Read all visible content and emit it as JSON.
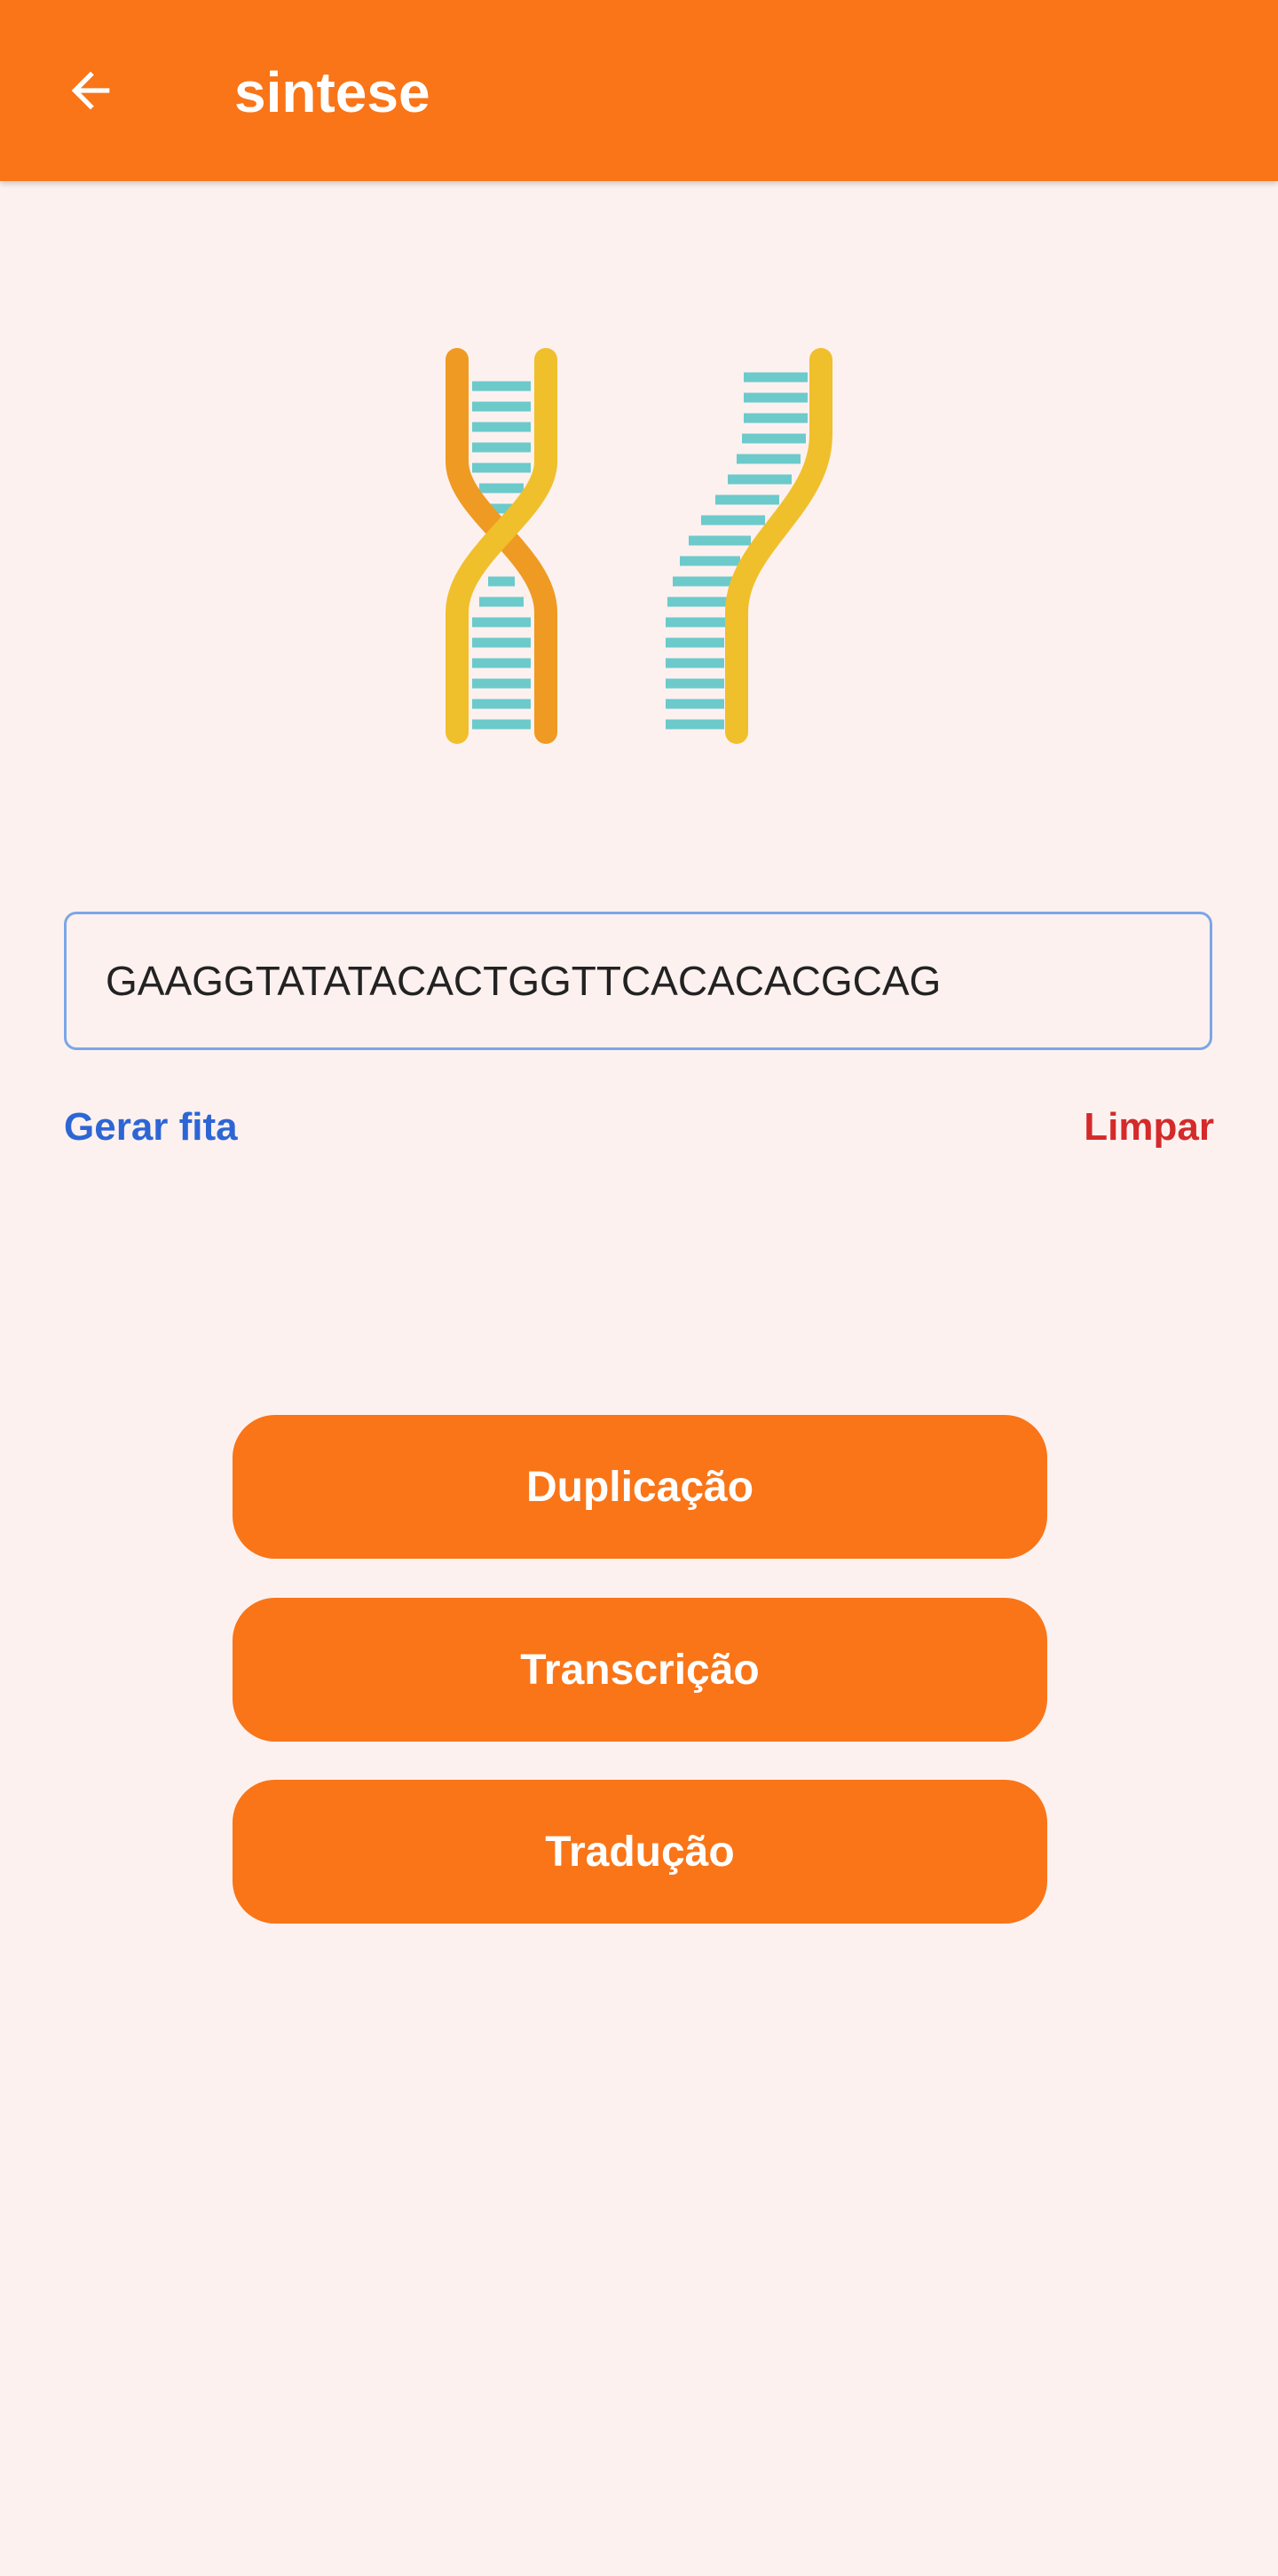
{
  "app_bar": {
    "title": "sintese",
    "back_icon": "arrow-back-icon",
    "background": "#f97518"
  },
  "illustration": {
    "icon": "dna-icon",
    "strand_colors": {
      "orange": "#ef9a22",
      "yellow": "#f0bf2c",
      "rungs": "#6ccacb"
    }
  },
  "sequence": {
    "value": "GAAGGTATATACACTGGTTCACACACGCAG"
  },
  "links": {
    "generate_label": "Gerar fita",
    "clear_label": "Limpar",
    "generate_color": "#2d66d4",
    "clear_color": "#d42a2a"
  },
  "actions": {
    "duplication_label": "Duplicação",
    "transcription_label": "Transcrição",
    "translation_label": "Tradução"
  },
  "colors": {
    "accent": "#f97518",
    "background": "#fdf1f0",
    "input_border": "#7aa7e6"
  }
}
